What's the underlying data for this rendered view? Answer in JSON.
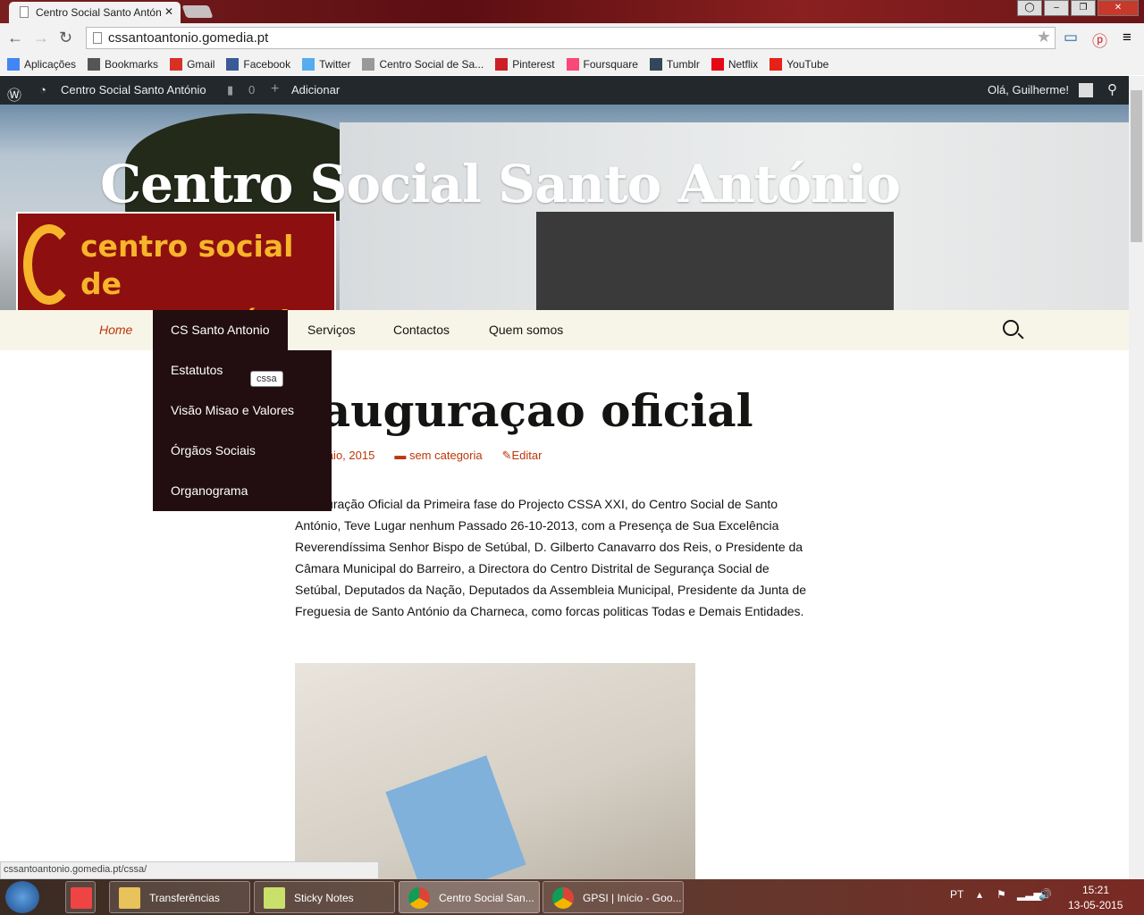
{
  "browser": {
    "tab_title": "Centro Social Santo Antón",
    "url": "cssantoantonio.gomedia.pt",
    "status_url": "cssantoantonio.gomedia.pt/cssa/"
  },
  "bookmarks": [
    {
      "label": "Aplicações",
      "color": "#4285f4"
    },
    {
      "label": "Bookmarks",
      "color": "#555555"
    },
    {
      "label": "Gmail",
      "color": "#d93025"
    },
    {
      "label": "Facebook",
      "color": "#3b5998"
    },
    {
      "label": "Twitter",
      "color": "#55acee"
    },
    {
      "label": "Centro Social de Sa...",
      "color": "#999999"
    },
    {
      "label": "Pinterest",
      "color": "#cb2027"
    },
    {
      "label": "Foursquare",
      "color": "#f94877"
    },
    {
      "label": "Tumblr",
      "color": "#35465c"
    },
    {
      "label": "Netflix",
      "color": "#e50914"
    },
    {
      "label": "YouTube",
      "color": "#e62117"
    }
  ],
  "wpbar": {
    "site": "Centro Social Santo António",
    "comments": "0",
    "add": "Adicionar",
    "greeting": "Olá, Guilherme!"
  },
  "site": {
    "title": "Centro Social Santo António",
    "logo_line1": "centro social de",
    "logo_line2": "santo antónio"
  },
  "menu": {
    "items": [
      "Home",
      "CS Santo Antonio",
      "Serviços",
      "Contactos",
      "Quem somos"
    ],
    "dropdown": [
      "Estatutos",
      "Visão Misao e Valores",
      "Órgãos Sociais",
      "Organograma"
    ],
    "tooltip": "cssa"
  },
  "post": {
    "title": "Inauguraçao oficial",
    "date": "Maio, 2015",
    "category": "sem categoria",
    "edit": "Editar",
    "body": "Inauguração Oficial da Primeira fase do Projecto CSSA XXI, do Centro Social de Santo António, Teve Lugar nenhum Passado 26-10-2013, com a Presença de Sua Excelência Reverendíssima Senhor Bispo de Setúbal, D. Gilberto Canavarro dos Reis, o Presidente da Câmara Municipal do Barreiro, a Directora do Centro Distrital de Segurança Social de Setúbal, Deputados da Nação, Deputados da Assembleia Municipal, Presidente da Junta de Freguesia de Santo António da Charneca, como forcas politicas Todas e Demais Entidades."
  },
  "taskbar": {
    "items": [
      "Transferências",
      "Sticky Notes",
      "Centro Social San...",
      "GPSI | Início - Goo..."
    ],
    "lang": "PT",
    "time": "15:21",
    "date": "13-05-2015"
  }
}
